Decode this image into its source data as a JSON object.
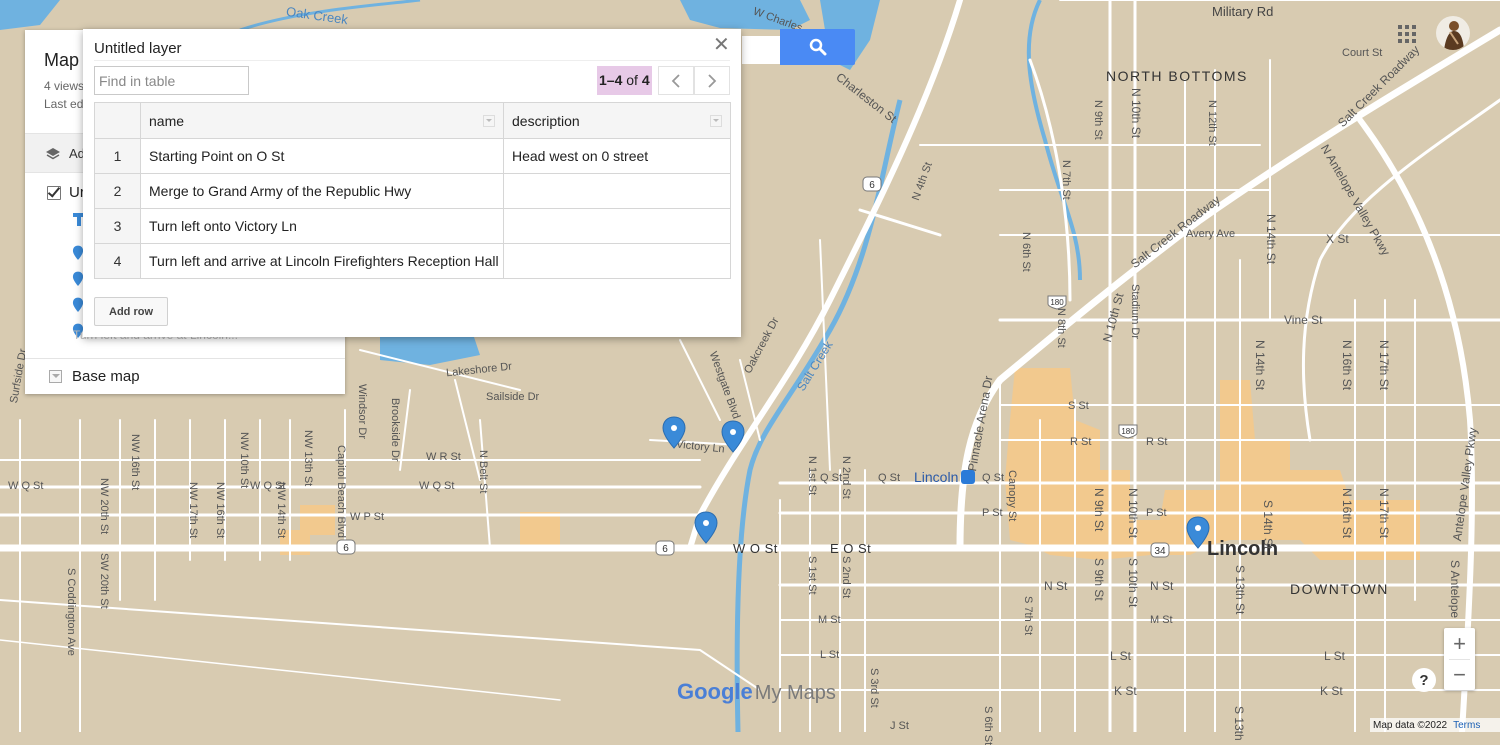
{
  "map": {
    "labels": {
      "oak_creek": "Oak Creek",
      "charleston_1": "W Charles",
      "charleston": "Charleston St",
      "military": "Military Rd",
      "north_bottoms": "NORTH BOTTOMS",
      "court_st": "Court St",
      "salt_creek_rdwy": "Salt Creek Roadway",
      "salt_creek_rdwy2": "Salt Creek Roadway",
      "antelope": "N Antelope Valley Pkwy",
      "n_9th": "N 9th St",
      "n_10th": "N 10th St",
      "n_12th": "N 12th St",
      "n_14th": "N 14th St",
      "avery": "Avery Ave",
      "x_st": "X St",
      "n_7th": "N 7th St",
      "n_4th": "N 4th St",
      "n_6th": "N 6th St",
      "n_10th_b": "N 10th St",
      "n_8th": "N 8th St",
      "stadium": "Stadium Dr",
      "vine": "Vine St",
      "n_14th_b": "N 14th St",
      "n_16th": "N 16th St",
      "n_17th": "N 17th St",
      "salt_creek": "Salt Creek",
      "westgate": "Westgate Blvd",
      "oakcreek_dr": "Oakcreek Dr",
      "lakeshore": "Lakeshore Dr",
      "sailside": "Sailside Dr",
      "windsor": "Windsor Dr",
      "brookside": "Brookside Dr",
      "surfside": "Surfside Dr",
      "pinnacle": "Pinnacle Arena Dr",
      "victory": "Victory Ln",
      "w_r_st": "W R St",
      "w_q_st": "W Q St",
      "w_q_st2": "W Q St",
      "w_q_st3": "W Q St",
      "w_p_st": "W P St",
      "w_o_st": "W O St",
      "e_o_st": "E O St",
      "q_st": "Q St",
      "q_st2": "Q St",
      "q_st3": "Q St",
      "p_st": "P St",
      "p_st2": "P St",
      "r_st": "R St",
      "r_st2": "R St",
      "s_st": "S St",
      "n_st": "N St",
      "n_st2": "N St",
      "m_st": "M St",
      "m_st2": "M St",
      "l_st": "L St",
      "l_st2": "L St",
      "l_st3": "L St",
      "k_st": "K St",
      "k_st2": "K St",
      "j_st": "J St",
      "lincoln_big": "Lincoln",
      "downtown": "DOWNTOWN",
      "lincoln_stn": "Lincoln",
      "nw_20th": "NW 20th St",
      "nw_17th": "NW 17th St",
      "nw_16th": "NW 16th St",
      "nw_14th": "NW 14th St",
      "nw_13th": "NW 13th St",
      "nw_16th_b": "NW 16th St",
      "nw_10th": "NW 10th St",
      "sw_20th": "SW 20th St",
      "s_coddington": "S Coddington Ave",
      "capitol": "Capitol Beach Blvd",
      "n_belt": "N Belt St",
      "n_9th_b": "N 9th St",
      "n_10th_c": "N 10th St",
      "s_9th": "S 9th St",
      "s_10th": "S 10th St",
      "s_13th": "S 13th St",
      "s_14th": "S 14th St",
      "n_16th_b": "N 16th St",
      "n_17th_b": "N 17th St",
      "s_antelope": "S Antelope",
      "antelope2": "Antelope Valley Pkwy",
      "canopy": "Canopy St",
      "n_1st": "N 1st St",
      "n_2nd": "N 2nd St",
      "s_1st": "S 1st St",
      "s_2nd": "S 2nd St",
      "s_3rd": "S 3rd St",
      "s_7th": "S 7th St",
      "s_6th": "S 6th St",
      "s_13th_b": "S 13th"
    },
    "shields": {
      "us6": "6",
      "us34": "34",
      "i180": "180"
    },
    "colors": {
      "land": "#d8cbb1",
      "water": "#6fb2e0",
      "road": "#ffffff",
      "downtown": "#f2c98e",
      "pin": "#3a8ad8"
    }
  },
  "search": {
    "button_icon": "search-icon"
  },
  "left_panel": {
    "title": "Map t",
    "views": "4 views",
    "last_edited": "Last ed",
    "add_layer": "Ad",
    "layer_name": "Ur",
    "hidden_item": "Turn left and arrive at Lincoln...",
    "base_map": "Base map"
  },
  "data_table": {
    "title": "Untitled layer",
    "close_icon": "close-icon",
    "find_placeholder": "Find in table",
    "pager_range": "1–4",
    "pager_of": " of ",
    "pager_total": "4",
    "columns": [
      "name",
      "description"
    ],
    "rows": [
      {
        "n": "1",
        "name": "Starting Point on O St",
        "description": "Head west on 0 street"
      },
      {
        "n": "2",
        "name": "Merge to Grand Army of the Republic Hwy",
        "description": ""
      },
      {
        "n": "3",
        "name": "Turn left onto Victory Ln",
        "description": ""
      },
      {
        "n": "4",
        "name": "Turn left and arrive at Lincoln Firefighters Reception Hall",
        "description": ""
      }
    ],
    "add_row": "Add row"
  },
  "controls": {
    "zoom_in": "+",
    "zoom_out": "−",
    "help": "?",
    "map_data": "Map data ©2022",
    "terms": "Terms",
    "logo_google": "Google",
    "logo_mymaps": "My Maps"
  }
}
